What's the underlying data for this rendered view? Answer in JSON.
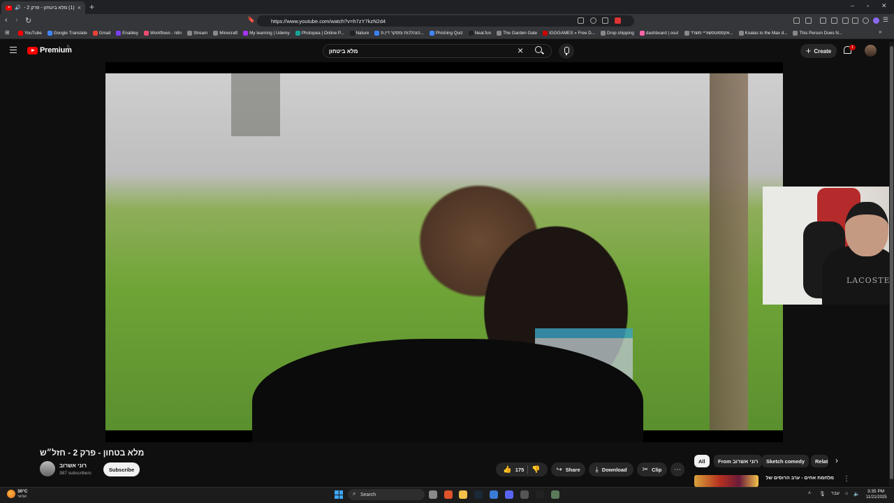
{
  "browser": {
    "tab_title": "(1) מלא ביטחון - פרק 2 - חזל״",
    "url": "https://www.youtube.com/watch?v=h7zY7kzN2d4",
    "bookmarks": [
      {
        "label": "YouTube",
        "color": "#ff0000"
      },
      {
        "label": "Google Translate",
        "color": "#4285f4"
      },
      {
        "label": "Gmail",
        "color": "#ea4335"
      },
      {
        "label": "Enabley",
        "color": "#7b3ff2"
      },
      {
        "label": "Workflows - n8n",
        "color": "#ea4b71"
      },
      {
        "label": "Stream",
        "color": "#888888"
      },
      {
        "label": "Minecraft",
        "color": "#888888"
      },
      {
        "label": "My learning | Udemy",
        "color": "#a435f0"
      },
      {
        "label": "Photopea | Online P...",
        "color": "#18a497"
      },
      {
        "label": "Nature",
        "color": "#222222"
      },
      {
        "label": "הגהלכות ומסקר דין פ...",
        "color": "#3b82f6"
      },
      {
        "label": "Phishing Quiz",
        "color": "#4285f4"
      },
      {
        "label": "Neal.fun",
        "color": "#222222"
      },
      {
        "label": "The Garden Gate",
        "color": "#888888"
      },
      {
        "label": "IGGGAMES » Free D...",
        "color": "#cc0000"
      },
      {
        "label": "Drop shipping",
        "color": "#888888"
      },
      {
        "label": "dashboard | osu!",
        "color": "#ff66aa"
      },
      {
        "label": "אקספוטסשוריי משרד...",
        "color": "#888888"
      },
      {
        "label": "Koalas to the Max d...",
        "color": "#888888"
      },
      {
        "label": "This Person Does N...",
        "color": "#888888"
      }
    ]
  },
  "masthead": {
    "logo_text": "Premium",
    "logo_sup": "IL",
    "search_query": "מלא ביטחון",
    "create_label": "Create",
    "notification_count": "1"
  },
  "video": {
    "title": "מלא בטחון - פרק 2 - חזל״ש",
    "channel_name": "רוני אשרוב",
    "subscribers": "387 subscribers",
    "subscribe_label": "Subscribe",
    "like_count": "175",
    "share_label": "Share",
    "download_label": "Download",
    "clip_label": "Clip",
    "webcam_shirt_text": "LACOSTE"
  },
  "sidebar": {
    "chips": [
      "All",
      "From רוני אשרוב",
      "Sketch comedy",
      "Relat"
    ],
    "rec_title": "מלחמת אחים - ערב הרוסים של"
  },
  "taskbar": {
    "temperature": "30°C",
    "weather_desc": "שמשי",
    "search_placeholder": "Search",
    "language": "עבר",
    "time": "3:35 PM",
    "date": "11/21/2025"
  },
  "colors": {
    "youtube_red": "#ff0000",
    "background": "#0f0f0f",
    "chip_bg": "#272727",
    "link_blue": "#3ea6ff"
  }
}
